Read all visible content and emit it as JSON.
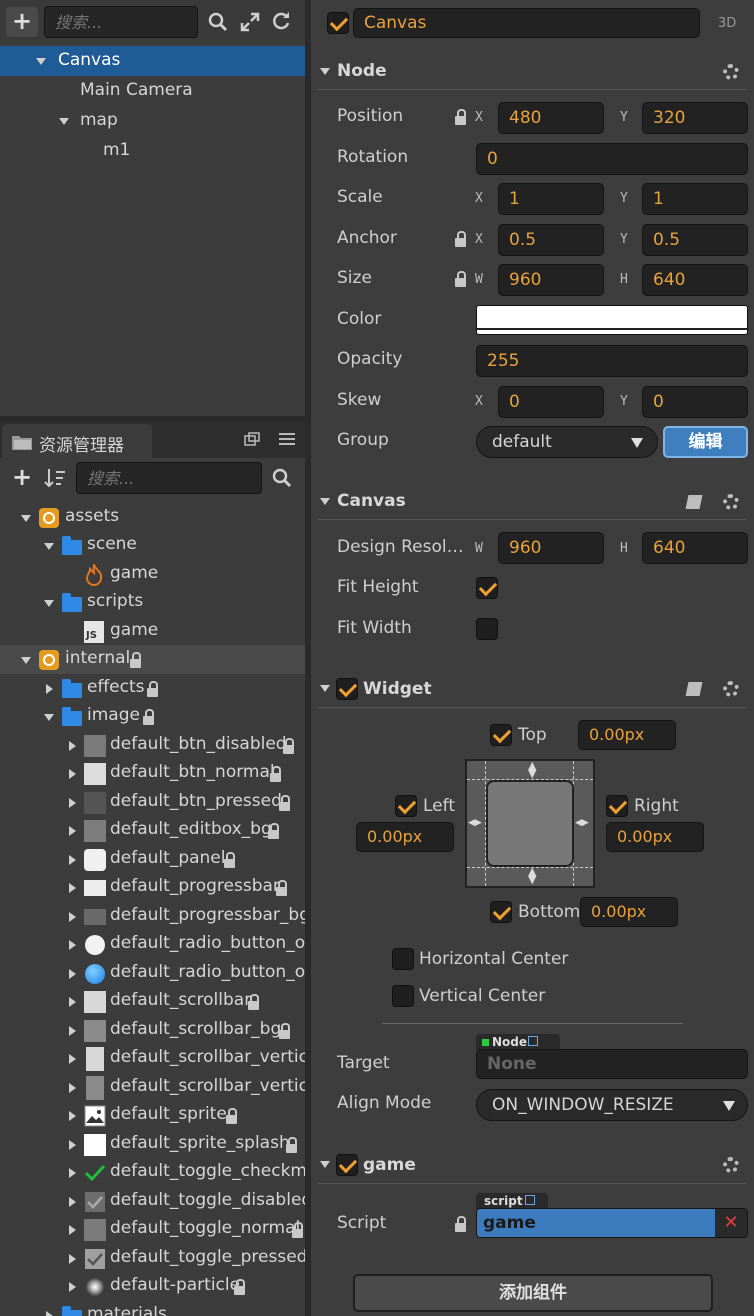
{
  "hierarchy": {
    "search_placeholder": "搜索...",
    "nodes": [
      {
        "label": "Canvas",
        "selected": true
      },
      {
        "label": "Main Camera"
      },
      {
        "label": "map"
      },
      {
        "label": "m1"
      }
    ]
  },
  "assets": {
    "tab_title": "资源管理器",
    "search_placeholder": "搜索...",
    "items": [
      {
        "label": "assets"
      },
      {
        "label": "scene"
      },
      {
        "label": "game"
      },
      {
        "label": "scripts"
      },
      {
        "label": "game"
      },
      {
        "label": "internal"
      },
      {
        "label": "effects"
      },
      {
        "label": "image"
      },
      {
        "label": "default_btn_disabled"
      },
      {
        "label": "default_btn_normal"
      },
      {
        "label": "default_btn_pressed"
      },
      {
        "label": "default_editbox_bg"
      },
      {
        "label": "default_panel"
      },
      {
        "label": "default_progressbar"
      },
      {
        "label": "default_progressbar_bg"
      },
      {
        "label": "default_radio_button_off"
      },
      {
        "label": "default_radio_button_on"
      },
      {
        "label": "default_scrollbar"
      },
      {
        "label": "default_scrollbar_bg"
      },
      {
        "label": "default_scrollbar_vertical"
      },
      {
        "label": "default_scrollbar_vertical_bg"
      },
      {
        "label": "default_sprite"
      },
      {
        "label": "default_sprite_splash"
      },
      {
        "label": "default_toggle_checkmark"
      },
      {
        "label": "default_toggle_disabled"
      },
      {
        "label": "default_toggle_normal"
      },
      {
        "label": "default_toggle_pressed"
      },
      {
        "label": "default-particle"
      },
      {
        "label": "materials"
      }
    ]
  },
  "inspector": {
    "node_name": "Canvas",
    "mode_label": "3D",
    "node_section": {
      "title": "Node",
      "position": {
        "label": "Position",
        "x": "480",
        "y": "320"
      },
      "rotation": {
        "label": "Rotation",
        "value": "0"
      },
      "scale": {
        "label": "Scale",
        "x": "1",
        "y": "1"
      },
      "anchor": {
        "label": "Anchor",
        "x": "0.5",
        "y": "0.5"
      },
      "size": {
        "label": "Size",
        "w": "960",
        "h": "640"
      },
      "color": {
        "label": "Color",
        "value": "#ffffff"
      },
      "opacity": {
        "label": "Opacity",
        "value": "255"
      },
      "skew": {
        "label": "Skew",
        "x": "0",
        "y": "0"
      },
      "group": {
        "label": "Group",
        "value": "default",
        "edit_label": "编辑"
      }
    },
    "canvas_section": {
      "title": "Canvas",
      "design_resolution": {
        "label": "Design Resol…",
        "w": "960",
        "h": "640"
      },
      "fit_height": {
        "label": "Fit Height",
        "checked": true
      },
      "fit_width": {
        "label": "Fit Width",
        "checked": false
      }
    },
    "widget_section": {
      "title": "Widget",
      "top": {
        "label": "Top",
        "value": "0.00px"
      },
      "left": {
        "label": "Left",
        "value": "0.00px"
      },
      "right": {
        "label": "Right",
        "value": "0.00px"
      },
      "bottom": {
        "label": "Bottom",
        "value": "0.00px"
      },
      "horizontal_center": "Horizontal Center",
      "vertical_center": "Vertical Center",
      "target": {
        "label": "Target",
        "tag": "Node",
        "value": "None"
      },
      "align_mode": {
        "label": "Align Mode",
        "value": "ON_WINDOW_RESIZE"
      }
    },
    "game_section": {
      "title": "game",
      "script": {
        "label": "Script",
        "tag": "script",
        "value": "game"
      }
    },
    "add_component_label": "添加组件",
    "axis": {
      "x": "X",
      "y": "Y",
      "w": "W",
      "h": "H"
    }
  },
  "colors": {
    "accent": "#f0a030",
    "selection": "#1f5b96",
    "edit_button": "#3f7fbf",
    "script_field": "#3d7bbf"
  }
}
